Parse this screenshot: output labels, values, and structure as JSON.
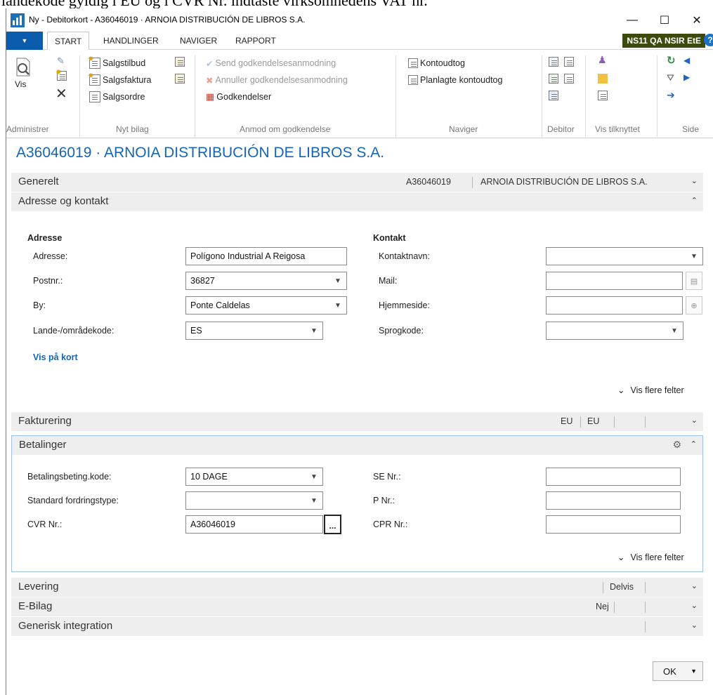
{
  "top_text": "landekode gyldig i EU og i CVR Nr. indtaste virksomhedens VAT nr.",
  "window": {
    "title": "Ny - Debitorkort - A36046019 · ARNOIA DISTRIBUCIÓN DE LIBROS S.A.",
    "minimize": "—",
    "maximize": "☐",
    "close": "✕"
  },
  "ribbon_tabs": {
    "file_arrow": "▼",
    "items": [
      "START",
      "HANDLINGER",
      "NAVIGER",
      "RAPPORT"
    ],
    "active": "START",
    "company": "NS11 QA NSIR EtE",
    "help": "?"
  },
  "ribbon": {
    "administrer": {
      "label": "Administrer",
      "vis": "Vis"
    },
    "nyt_bilag": {
      "label": "Nyt bilag",
      "items": [
        "Salgstilbud",
        "Salgsfaktura",
        "Salgsordre"
      ]
    },
    "anmod": {
      "label": "Anmod om godkendelse",
      "items": [
        "Send godkendelsesanmodning",
        "Annuller godkendelsesanmodning",
        "Godkendelser"
      ]
    },
    "naviger": {
      "label": "Naviger",
      "items": [
        "Kontoudtog",
        "Planlagte kontoudtog"
      ]
    },
    "debitor": {
      "label": "Debitor"
    },
    "vis_tilknyttet": {
      "label": "Vis tilknyttet"
    },
    "side": {
      "label": "Side"
    }
  },
  "page_title": "A36046019 · ARNOIA DISTRIBUCIÓN DE LIBROS S.A.",
  "sections": {
    "generelt": {
      "title": "Generelt",
      "no": "A36046019",
      "name": "ARNOIA DISTRIBUCIÓN DE LIBROS S.A."
    },
    "adresse": {
      "title": "Adresse og kontakt"
    },
    "fakturering": {
      "title": "Fakturering",
      "v1": "EU",
      "v2": "EU"
    },
    "betalinger": {
      "title": "Betalinger"
    },
    "levering": {
      "title": "Levering",
      "v1": "Delvis"
    },
    "ebilag": {
      "title": "E-Bilag",
      "v1": "Nej"
    },
    "generisk": {
      "title": "Generisk integration"
    },
    "chev_down": "⌄",
    "chev_up": "⌃"
  },
  "address": {
    "heading": "Adresse",
    "fields": {
      "adresse": {
        "label": "Adresse:",
        "value": "Polígono Industrial A Reigosa"
      },
      "postnr": {
        "label": "Postnr.:",
        "value": "36827"
      },
      "by": {
        "label": "By:",
        "value": "Ponte Caldelas"
      },
      "lande": {
        "label": "Lande-/områdekode:",
        "value": "ES"
      }
    },
    "map_link": "Vis på kort"
  },
  "contact": {
    "heading": "Kontakt",
    "fields": {
      "kontaktnavn": {
        "label": "Kontaktnavn:",
        "value": ""
      },
      "mail": {
        "label": "Mail:",
        "value": ""
      },
      "hjemmeside": {
        "label": "Hjemmeside:",
        "value": ""
      },
      "sprogkode": {
        "label": "Sprogkode:",
        "value": ""
      }
    }
  },
  "payments": {
    "fields": {
      "betalingsbeting": {
        "label": "Betalingsbeting.kode:",
        "value": "10 DAGE"
      },
      "fordringstype": {
        "label": "Standard fordringstype:",
        "value": ""
      },
      "cvr": {
        "label": "CVR Nr.:",
        "value": "A36046019"
      },
      "se": {
        "label": "SE Nr.:",
        "value": ""
      },
      "p": {
        "label": "P Nr.:",
        "value": ""
      },
      "cpr": {
        "label": "CPR Nr.:",
        "value": ""
      }
    },
    "assist": "..."
  },
  "more_fields": "Vis flere felter",
  "ok_button": "OK"
}
